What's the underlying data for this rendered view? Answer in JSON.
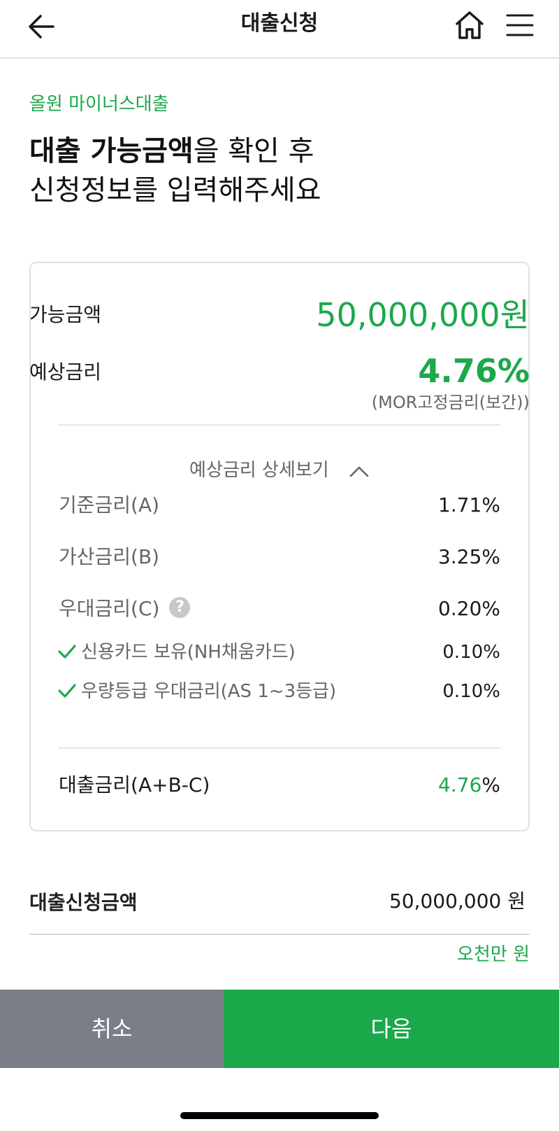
{
  "header": {
    "title": "대출신청",
    "back_icon": "arrow-left-icon",
    "home_icon": "home-icon",
    "menu_icon": "hamburger-menu-icon"
  },
  "product": {
    "name": "올원 마이너스대출"
  },
  "headline": {
    "line1_bold": "대출 가능금액",
    "line1_rest": "을 확인 후",
    "line2": "신청정보를 입력해주세요"
  },
  "summary": {
    "available_label": "가능금액",
    "available_value": "50,000,000원",
    "rate_label": "예상금리",
    "rate_value": "4.76%",
    "rate_type": "(MOR고정금리(보간))"
  },
  "detail": {
    "toggle_label": "예상금리 상세보기",
    "toggle_icon": "chevron-up-icon",
    "base_label": "기준금리(A)",
    "base_value": "1.71%",
    "add_label": "가산금리(B)",
    "add_value": "3.25%",
    "pref_label": "우대금리(C)",
    "pref_value": "0.20%",
    "help_icon": "question-circle-icon",
    "help_glyph": "?",
    "benefits": [
      {
        "label": "신용카드 보유(NH채움카드)",
        "value": "0.10%"
      },
      {
        "label": "우량등급 우대금리(AS 1~3등급)",
        "value": "0.10%"
      }
    ],
    "check_icon": "check-icon",
    "total_label": "대출금리(A+B-C)",
    "total_value_num": "4.76",
    "total_value_unit": "%"
  },
  "application": {
    "amount_label": "대출신청금액",
    "amount_value": "50,000,000 원",
    "amount_korean": "오천만 원"
  },
  "buttons": {
    "cancel": "취소",
    "next": "다음"
  },
  "colors": {
    "accent": "#1ba84b",
    "cancel_bg": "#7a7f87"
  }
}
